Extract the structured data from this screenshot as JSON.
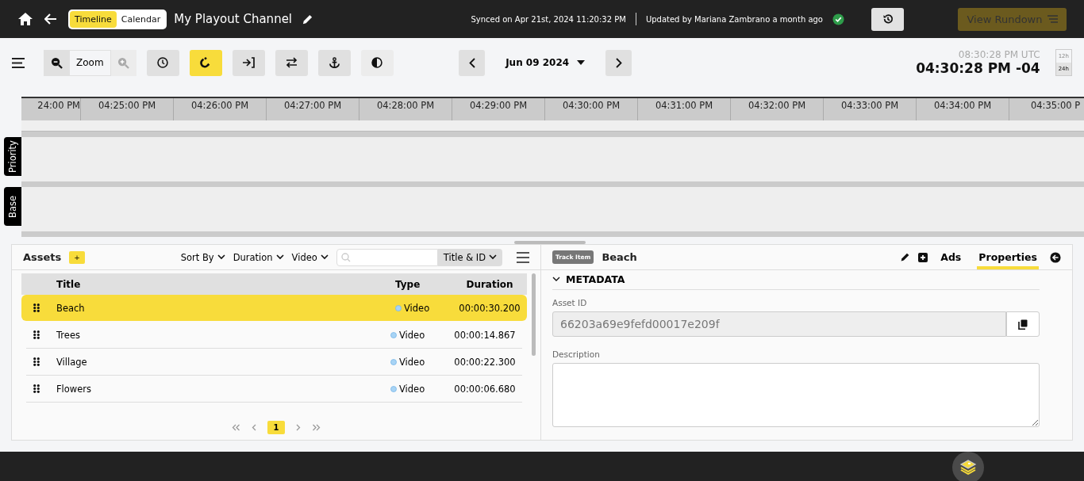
{
  "header": {
    "view_tabs": [
      {
        "label": "Timeline",
        "selected": true
      },
      {
        "label": "Calendar",
        "selected": false
      }
    ],
    "channel_title": "My Playout Channel",
    "synced": "Synced on Apr 21st, 2024 11:20:32 PM",
    "updated": "Updated by Mariana Zambrano a month ago",
    "view_rundown": {
      "label": "View Rundown",
      "disabled": true
    }
  },
  "toolbar": {
    "zoom_label": "Zoom",
    "zoom_in_disabled": true,
    "tools": [
      {
        "kind": "clock",
        "active": false,
        "disabled": false
      },
      {
        "kind": "magnet",
        "active": true,
        "disabled": false
      },
      {
        "kind": "enter",
        "active": false,
        "disabled": false
      },
      {
        "kind": "swap",
        "active": false,
        "disabled": false
      },
      {
        "kind": "anchor",
        "active": false,
        "disabled": false
      },
      {
        "kind": "contrast",
        "active": false,
        "disabled": true
      }
    ],
    "date": "Jun 09 2024",
    "utc_time": "08:30:28 PM UTC",
    "local_time": "04:30:28 PM -04",
    "clock_formats": [
      {
        "label": "12h",
        "selected": false
      },
      {
        "label": "24h",
        "selected": true
      }
    ]
  },
  "timeline": {
    "ticks": [
      "24:00 PM",
      "04:25:00 PM",
      "04:26:00 PM",
      "04:27:00 PM",
      "04:28:00 PM",
      "04:29:00 PM",
      "04:30:00 PM",
      "04:31:00 PM",
      "04:32:00 PM",
      "04:33:00 PM",
      "04:34:00 PM",
      "04:35:00 P"
    ],
    "tracks": [
      "Priority",
      "Base"
    ]
  },
  "assets": {
    "title": "Assets",
    "add": "+",
    "filters": [
      "Sort By",
      "Duration",
      "Video"
    ],
    "search_scope": "Title & ID",
    "columns": [
      "Title",
      "Type",
      "Duration"
    ],
    "rows": [
      {
        "title": "Beach",
        "type": "Video",
        "duration": "00:00:30.200",
        "selected": true
      },
      {
        "title": "Trees",
        "type": "Video",
        "duration": "00:00:14.867",
        "selected": false
      },
      {
        "title": "Village",
        "type": "Video",
        "duration": "00:00:22.300",
        "selected": false
      },
      {
        "title": "Flowers",
        "type": "Video",
        "duration": "00:00:06.680",
        "selected": false
      }
    ],
    "pages": [
      {
        "label": "1",
        "selected": true
      }
    ]
  },
  "details": {
    "badge": "Track Item",
    "title": "Beach",
    "tabs": [
      {
        "label": "Ads",
        "selected": false
      },
      {
        "label": "Properties",
        "selected": true
      }
    ],
    "section": {
      "title": "METADATA",
      "expanded": true
    },
    "fields": [
      {
        "label": "Asset ID",
        "value": "66203a69e9fefd00017e209f"
      },
      {
        "label": "Description"
      }
    ]
  }
}
